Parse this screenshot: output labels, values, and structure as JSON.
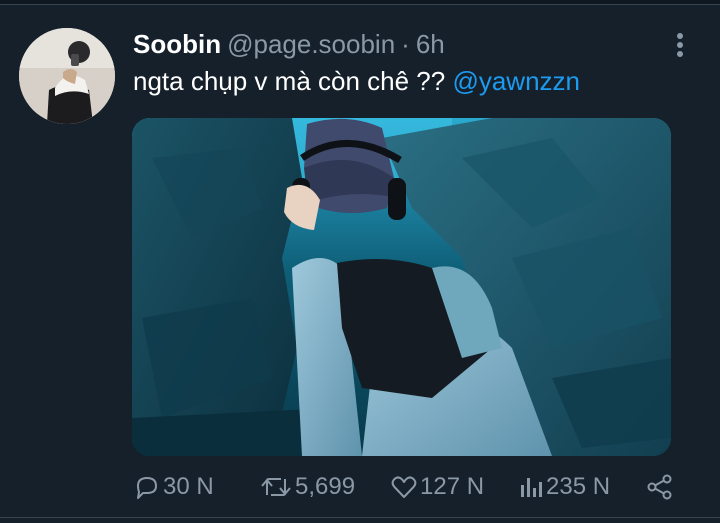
{
  "tweet": {
    "display_name": "Soobin",
    "handle": "@page.soobin",
    "separator": "·",
    "time": "6h",
    "text": "ngta chụp v mà còn chê ?? ",
    "mention": "@yawnzzn"
  },
  "actions": {
    "reply_count": "30 N",
    "retweet_count": "5,699",
    "like_count": "127 N",
    "views_count": "235 N"
  },
  "icons": {
    "reply": "reply-icon",
    "retweet": "retweet-icon",
    "like": "heart-icon",
    "views": "analytics-icon",
    "share": "share-icon",
    "more": "more-options-icon"
  },
  "colors": {
    "background": "#15202b",
    "text": "#ffffff",
    "secondary": "#8b98a5",
    "link": "#1d9bf0",
    "divider": "#38444d"
  }
}
